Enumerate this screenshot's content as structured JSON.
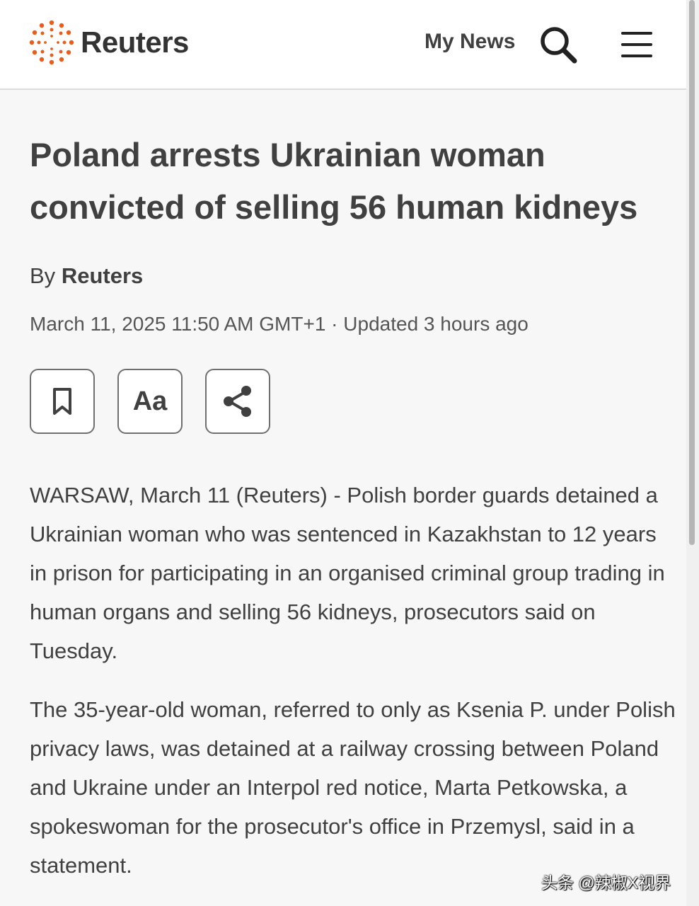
{
  "header": {
    "logo_text": "Reuters",
    "my_news_label": "My News",
    "search_icon": "search-icon",
    "menu_icon": "hamburger-menu-icon"
  },
  "article": {
    "headline": "Poland arrests Ukrainian woman convicted of selling 56 human kidneys",
    "byline_prefix": "By",
    "author": "Reuters",
    "dateline": "March 11, 2025 11:50 AM GMT+1 · Updated 3 hours ago",
    "actions": {
      "bookmark_icon": "bookmark-icon",
      "font_size_label": "Aa",
      "share_icon": "share-icon"
    },
    "paragraphs": [
      "WARSAW, March 11 (Reuters) - Polish border guards detained a Ukrainian woman who was sentenced in Kazakhstan to 12 years in prison for participating in an organised criminal group trading in human organs and selling 56 kidneys, prosecutors said on Tuesday.",
      "The 35-year-old woman, referred to only as Ksenia P. under Polish privacy laws, was detained at a railway crossing between Poland and Ukraine under an Interpol red notice, Marta Petkowska, a spokeswoman for the prosecutor's office in Przemysl, said in a statement."
    ]
  },
  "watermark": "头条 @辣椒X视界",
  "colors": {
    "brand_orange": "#e85d1c",
    "text": "#404040",
    "background": "#f7f7f7"
  }
}
